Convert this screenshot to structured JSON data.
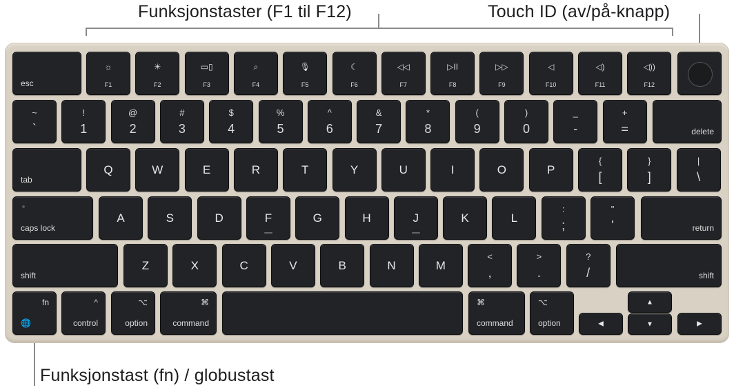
{
  "callouts": {
    "function_keys": "Funksjonstaster (F1 til F12)",
    "touch_id": "Touch ID (av/på-knapp)",
    "fn_globe": "Funksjonstast (fn) / globustast"
  },
  "colors": {
    "key": "#222326",
    "deck": "#d8d1c4",
    "callout_line": "#8a8a8a"
  },
  "row_function": [
    {
      "label": "esc"
    },
    {
      "icon": "brightness-down-icon",
      "glyph": "☼",
      "label": "F1"
    },
    {
      "icon": "brightness-up-icon",
      "glyph": "☀",
      "label": "F2"
    },
    {
      "icon": "mission-control-icon",
      "glyph": "▭▯",
      "label": "F3"
    },
    {
      "icon": "search-icon",
      "glyph": "⌕",
      "label": "F4"
    },
    {
      "icon": "microphone-icon",
      "glyph": "🎙",
      "label": "F5"
    },
    {
      "icon": "moon-icon",
      "glyph": "☾",
      "label": "F6"
    },
    {
      "icon": "rewind-icon",
      "glyph": "◁◁",
      "label": "F7"
    },
    {
      "icon": "play-pause-icon",
      "glyph": "▷II",
      "label": "F8"
    },
    {
      "icon": "fast-forward-icon",
      "glyph": "▷▷",
      "label": "F9"
    },
    {
      "icon": "mute-icon",
      "glyph": "◁",
      "label": "F10"
    },
    {
      "icon": "volume-down-icon",
      "glyph": "◁)",
      "label": "F11"
    },
    {
      "icon": "volume-up-icon",
      "glyph": "◁))",
      "label": "F12"
    }
  ],
  "row_number": [
    {
      "up": "~",
      "down": "`"
    },
    {
      "up": "!",
      "down": "1"
    },
    {
      "up": "@",
      "down": "2"
    },
    {
      "up": "#",
      "down": "3"
    },
    {
      "up": "$",
      "down": "4"
    },
    {
      "up": "%",
      "down": "5"
    },
    {
      "up": "^",
      "down": "6"
    },
    {
      "up": "&",
      "down": "7"
    },
    {
      "up": "*",
      "down": "8"
    },
    {
      "up": "(",
      "down": "9"
    },
    {
      "up": ")",
      "down": "0"
    },
    {
      "up": "_",
      "down": "-"
    },
    {
      "up": "+",
      "down": "="
    },
    {
      "label": "delete"
    }
  ],
  "row_tab": [
    {
      "label": "tab"
    },
    {
      "letter": "Q"
    },
    {
      "letter": "W"
    },
    {
      "letter": "E"
    },
    {
      "letter": "R"
    },
    {
      "letter": "T"
    },
    {
      "letter": "Y"
    },
    {
      "letter": "U"
    },
    {
      "letter": "I"
    },
    {
      "letter": "O"
    },
    {
      "letter": "P"
    },
    {
      "up": "{",
      "down": "["
    },
    {
      "up": "}",
      "down": "]"
    },
    {
      "up": "|",
      "down": "\\"
    }
  ],
  "row_caps": [
    {
      "label": "caps lock"
    },
    {
      "letter": "A"
    },
    {
      "letter": "S"
    },
    {
      "letter": "D"
    },
    {
      "letter": "F"
    },
    {
      "letter": "G"
    },
    {
      "letter": "H"
    },
    {
      "letter": "J"
    },
    {
      "letter": "K"
    },
    {
      "letter": "L"
    },
    {
      "up": ":",
      "down": ";"
    },
    {
      "up": "\"",
      "down": "'"
    },
    {
      "label": "return"
    }
  ],
  "row_shift": [
    {
      "label": "shift"
    },
    {
      "letter": "Z"
    },
    {
      "letter": "X"
    },
    {
      "letter": "C"
    },
    {
      "letter": "V"
    },
    {
      "letter": "B"
    },
    {
      "letter": "N"
    },
    {
      "letter": "M"
    },
    {
      "up": "<",
      "down": ","
    },
    {
      "up": ">",
      "down": "."
    },
    {
      "up": "?",
      "down": "/"
    },
    {
      "label": "shift"
    }
  ],
  "row_bottom": {
    "fn": {
      "label": "fn",
      "icon_glyph": "🌐"
    },
    "control": {
      "symbol": "^",
      "label": "control"
    },
    "option_left": {
      "symbol": "⌥",
      "label": "option"
    },
    "command_left": {
      "symbol": "⌘",
      "label": "command"
    },
    "command_right": {
      "symbol": "⌘",
      "label": "command"
    },
    "option_right": {
      "symbol": "⌥",
      "label": "option"
    },
    "arrow_left": "◀",
    "arrow_up": "▲",
    "arrow_down": "▼",
    "arrow_right": "▶"
  }
}
